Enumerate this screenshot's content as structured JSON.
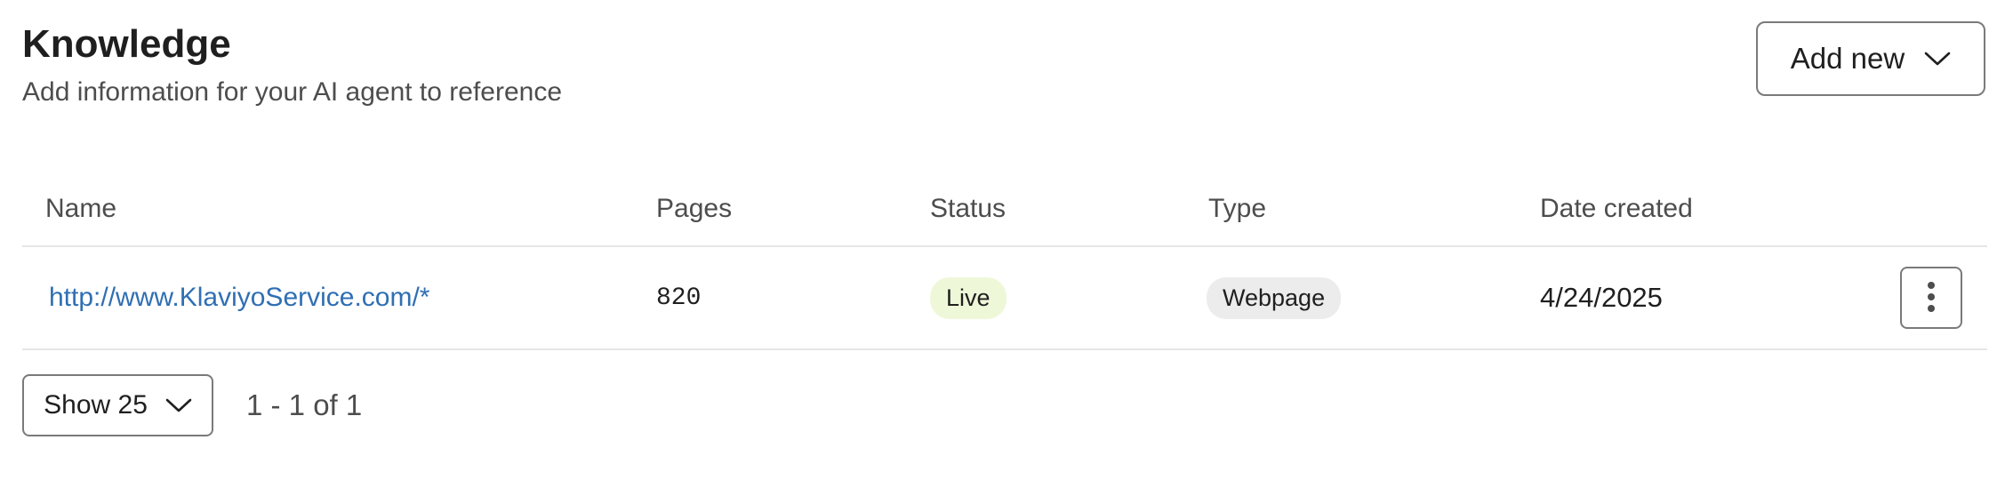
{
  "header": {
    "title": "Knowledge",
    "subtitle": "Add information for your AI agent to reference",
    "add_new_label": "Add new"
  },
  "table": {
    "columns": [
      "Name",
      "Pages",
      "Status",
      "Type",
      "Date created"
    ],
    "rows": [
      {
        "name": "http://www.KlaviyoService.com/*",
        "pages": "820",
        "status": "Live",
        "type": "Webpage",
        "date_created": "4/24/2025"
      }
    ]
  },
  "footer": {
    "page_size_label": "Show 25",
    "range_label": "1 - 1 of 1"
  },
  "colors": {
    "link": "#2f6fb3",
    "status_live_bg": "#eef8d9",
    "type_badge_bg": "#ececec",
    "border": "#7a7a7a"
  },
  "icons": {
    "add_new": "chevron-down-icon",
    "row_actions": "more-vertical-icon",
    "page_size": "chevron-down-icon"
  }
}
